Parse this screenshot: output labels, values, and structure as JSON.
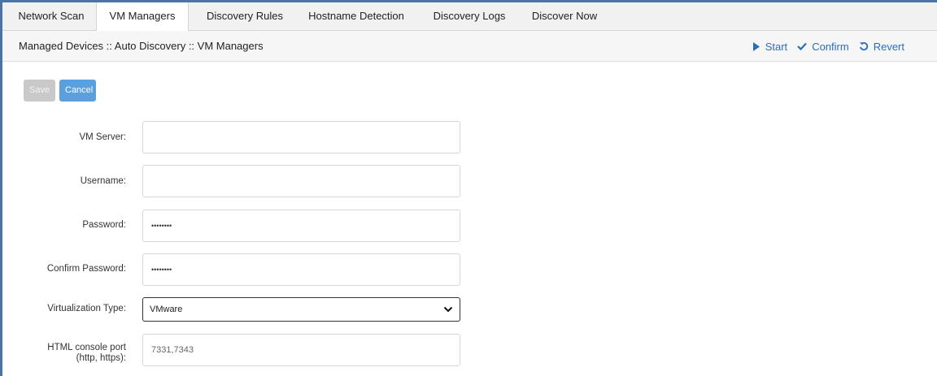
{
  "tabs": [
    {
      "label": "Network Scan",
      "active": false
    },
    {
      "label": "VM Managers",
      "active": true
    },
    {
      "label": "Discovery Rules",
      "active": false
    },
    {
      "label": "Hostname Detection",
      "active": false
    },
    {
      "label": "Discovery Logs",
      "active": false
    },
    {
      "label": "Discover Now",
      "active": false
    }
  ],
  "breadcrumb": "Managed Devices :: Auto Discovery :: VM Managers",
  "actions": {
    "start": "Start",
    "confirm": "Confirm",
    "revert": "Revert",
    "icons": [
      "play-icon",
      "check-icon",
      "revert-icon"
    ]
  },
  "buttons": {
    "save": "Save",
    "cancel": "Cancel"
  },
  "form": {
    "vm_server": {
      "label": "VM Server:",
      "value": ""
    },
    "username": {
      "label": "Username:",
      "value": ""
    },
    "password": {
      "label": "Password:",
      "value": "••••••••"
    },
    "confirm_password": {
      "label": "Confirm Password:",
      "value": "••••••••"
    },
    "virtualization_type": {
      "label": "Virtualization Type:",
      "value": "VMware"
    },
    "html_console_port": {
      "label_line1": "HTML console port",
      "label_line2": "(http, https):",
      "value": "7331,7343"
    }
  },
  "colors": {
    "accent": "#2a6ebb",
    "cancel_button": "#5b9fdc",
    "save_button_disabled": "#c9c9c9",
    "frame_border": "#4a73a8"
  }
}
